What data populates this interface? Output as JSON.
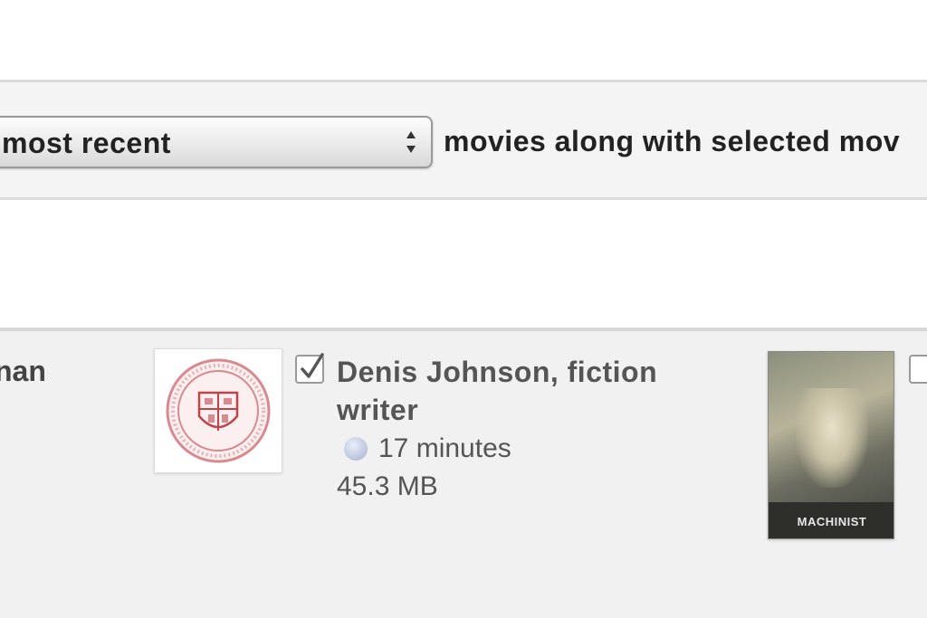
{
  "sync": {
    "popup_value": "most recent",
    "suffix_text": "movies along with selected mov"
  },
  "grid": {
    "previous_item_title_fragment": "nan",
    "items": [
      {
        "title": "Denis Johnson, fiction writer",
        "duration": "17 minutes",
        "size": "45.3 MB",
        "checked": true,
        "thumbnail_icon": "university-seal-icon"
      },
      {
        "poster_text": "MACHINIST",
        "checked": false,
        "thumbnail_icon": "movie-poster"
      }
    ]
  },
  "colors": {
    "sync_row_bg": "#f4f4f4",
    "grid_bg": "#f1f1f1",
    "seal_red": "#c0444a",
    "cloud_blue": "#b9c4dc"
  }
}
